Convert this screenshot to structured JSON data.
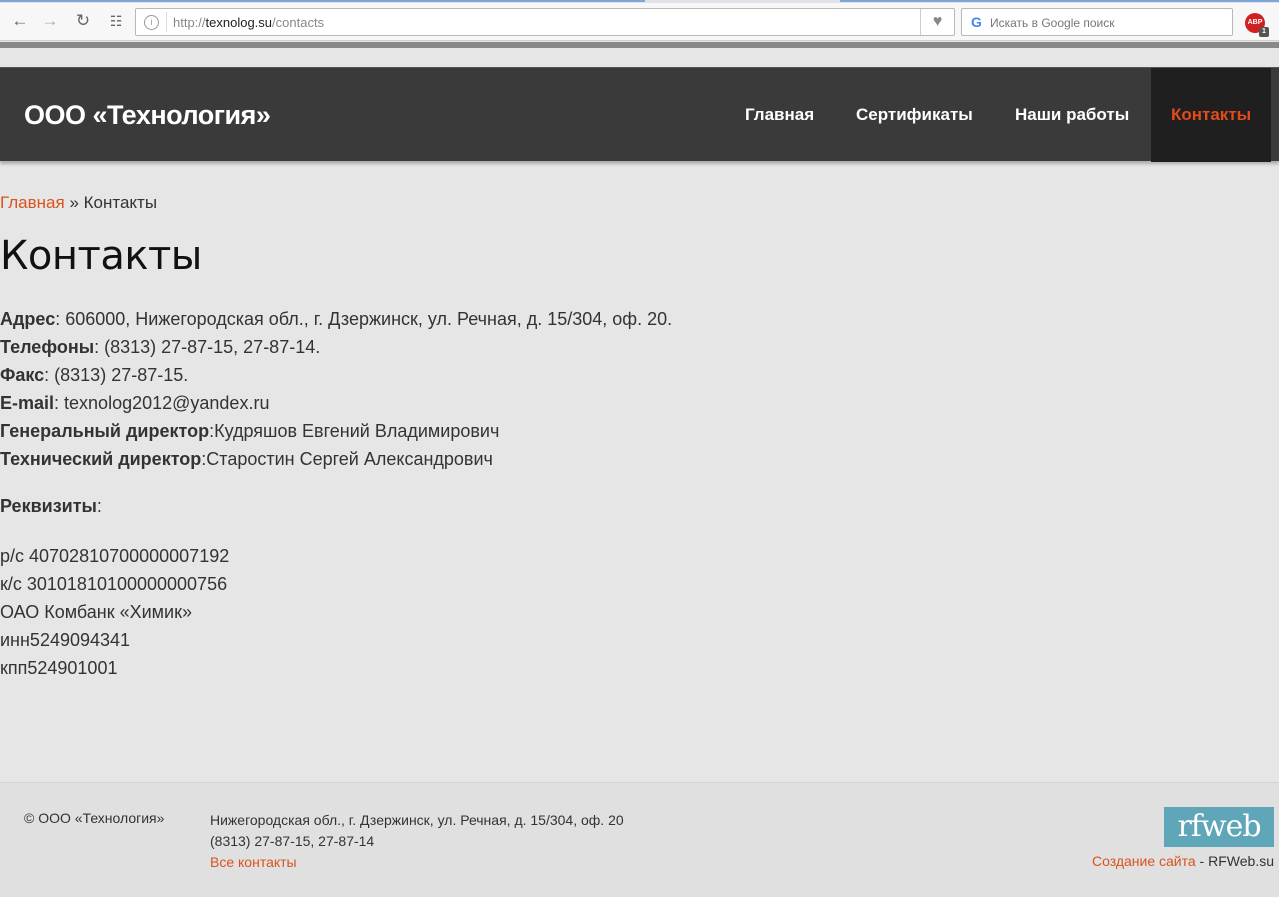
{
  "browser": {
    "url_prefix": "http://",
    "url_host": "texnolog.su",
    "url_path": "/contacts",
    "search_placeholder": "Искать в Google поиск",
    "adblock_label": "ABP",
    "adblock_count": "1",
    "icons": [
      "back-icon",
      "forward-icon",
      "reload-icon",
      "apps-grid-icon",
      "site-info-icon",
      "heart-icon",
      "google-icon",
      "adblock-icon"
    ]
  },
  "header": {
    "logo": "ООО «Технология»",
    "menu": [
      {
        "label": "Главная"
      },
      {
        "label": "Сертификаты"
      },
      {
        "label": "Наши работы"
      },
      {
        "label": "Контакты"
      }
    ],
    "active_color": "#e24b1c"
  },
  "breadcrumb": {
    "home": "Главная",
    "separator": " » ",
    "current": "Контакты"
  },
  "page_title": "Контакты",
  "contacts": {
    "address_label": "Адрес",
    "address_value": ": 606000, Нижегородская обл., г. Дзержинск, ул. Речная, д. 15/304, оф. 20.",
    "phones_label": "Телефоны",
    "phones_value": ": (8313) 27-87-15, 27-87-14.",
    "fax_label": "Факс",
    "fax_value": ": (8313) 27-87-15.",
    "email_label": "E-mail",
    "email_value": ": texnolog2012@yandex.ru",
    "gd_label": "Генеральный директор",
    "gd_value": ":Кудряшов Евгений Владимирович",
    "td_label": "Технический директор",
    "td_value": ":Старостин Сергей Александрович"
  },
  "requisites": {
    "label": "Реквизиты",
    "suffix": ":",
    "rows": [
      "р/с 40702810700000007192",
      "к/с 30101810100000000756",
      "ОАО Комбанк «Химик»",
      "инн5249094341",
      "кпп524901001"
    ]
  },
  "footer": {
    "copyright": "© ООО «Технология»",
    "address": "Нижегородская обл., г. Дзержинск, ул. Речная, д. 15/304, оф. 20",
    "phones": "(8313) 27-87-15, 27-87-14",
    "all_contacts": "Все контакты",
    "logo_text": "rfweb",
    "credit_link": "Создание сайта",
    "credit_sep": " - ",
    "credit_site": "RFWeb.su"
  }
}
